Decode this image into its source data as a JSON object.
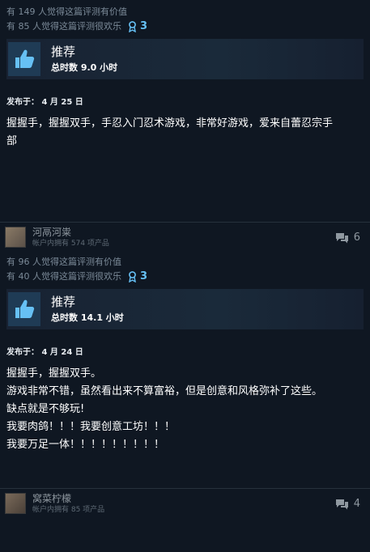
{
  "reviews": [
    {
      "helpful_text": "有 149 人觉得这篇评测有价值",
      "funny_text": "有 85 人觉得这篇评测很欢乐",
      "award_count": "3",
      "recommendation": "推荐",
      "hours": "总时数 9.0 小时",
      "posted": "发布于：  4 月 25 日",
      "lines": [
        "握握手，握握双手，手忍入门忍术游戏，非常好游戏，爱来自蕾忍宗手",
        "部"
      ]
    },
    {
      "helpful_text": "有 96 人觉得这篇评测有价值",
      "funny_text": "有 40 人觉得这篇评测很欢乐",
      "award_count": "3",
      "recommendation": "推荐",
      "hours": "总时数 14.1 小时",
      "posted": "发布于：  4 月 24 日",
      "lines": [
        "握握手，握握双手。",
        "游戏非常不错，虽然看出来不算富裕，但是创意和风格弥补了这些。",
        "缺点就是不够玩!",
        "我要肉鸽！！！我要创意工坊！！！",
        "我要万足一体！！！！！！！！！"
      ]
    }
  ],
  "users": [
    {
      "name": "河鬲河粜",
      "owned": "帐户内拥有 574 项产品",
      "comments": "6"
    },
    {
      "name": "窝菜柠檬",
      "owned": "帐户内拥有 85 项产品",
      "comments": "4"
    }
  ],
  "icons": {
    "thumb": "thumbs-up-icon",
    "award": "award-ribbon-icon",
    "comment": "comment-icon"
  },
  "colors": {
    "accent": "#66c0f4",
    "background": "#0f1722"
  }
}
